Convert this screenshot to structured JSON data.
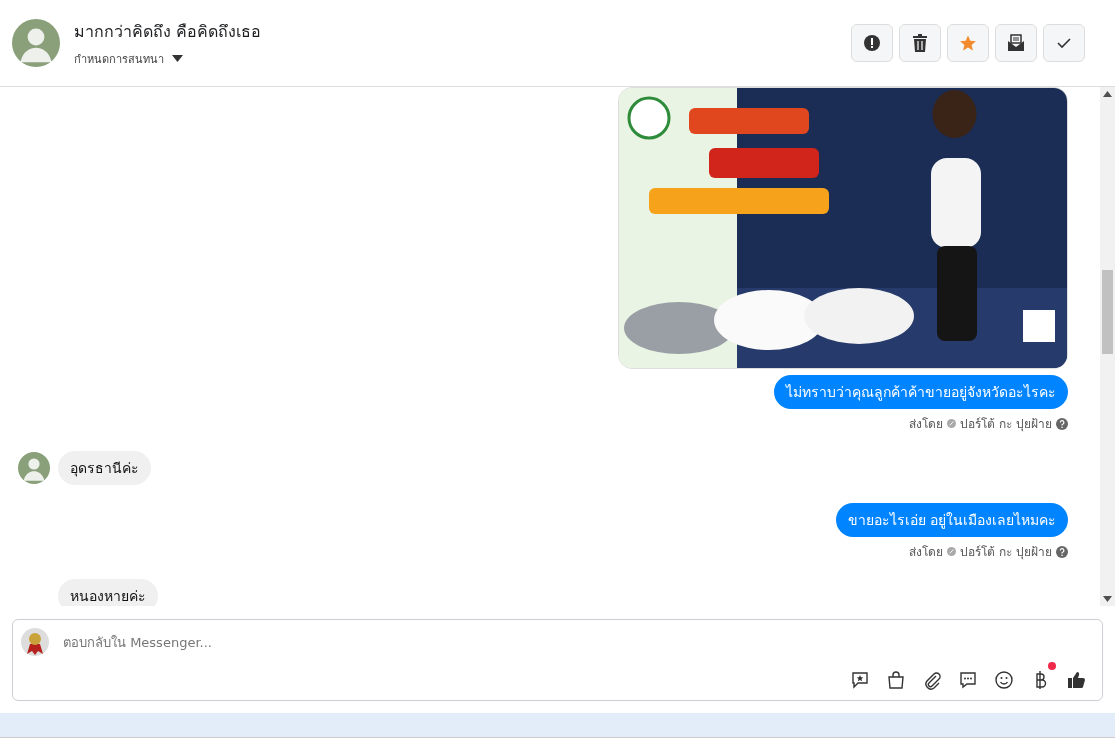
{
  "header": {
    "name": "มากกว่าคิดถึง คือคิดถึงเธอ",
    "subtitle": "กำหนดการสนทนา"
  },
  "actions": [
    {
      "kind": "alert",
      "on": false
    },
    {
      "kind": "trash",
      "on": false
    },
    {
      "kind": "star",
      "on": true
    },
    {
      "kind": "mail",
      "on": false
    },
    {
      "kind": "check",
      "on": false
    }
  ],
  "messages": [
    {
      "kind": "picture",
      "outgoing": true
    },
    {
      "kind": "text",
      "outgoing": true,
      "text": "ไม่ทราบว่าคุณลูกค้าค้าขายอยู่จังหวัดอะไรคะ",
      "sent_by_label": "ส่งโดย",
      "sender": "ปอร์โต้ กะ ปุยฝ้าย"
    },
    {
      "kind": "text",
      "outgoing": false,
      "avatar": true,
      "text": "อุดรธานีค่ะ"
    },
    {
      "kind": "text",
      "outgoing": true,
      "text": "ขายอะไรเอ่ย อยู่ในเมืองเลยไหมคะ",
      "sent_by_label": "ส่งโดย",
      "sender": "ปอร์โต้ กะ ปุยฝ้าย"
    },
    {
      "kind": "text",
      "outgoing": false,
      "avatar": false,
      "text": "หนองหายค่ะ"
    }
  ],
  "composer": {
    "placeholder": "ตอบกลับใน Messenger...",
    "tools": [
      {
        "kind": "saved-reply",
        "badge": false
      },
      {
        "kind": "shop",
        "badge": false
      },
      {
        "kind": "attach",
        "badge": false
      },
      {
        "kind": "chat",
        "badge": false
      },
      {
        "kind": "emoji",
        "badge": false
      },
      {
        "kind": "baht",
        "badge": true
      },
      {
        "kind": "like",
        "badge": false
      }
    ]
  }
}
